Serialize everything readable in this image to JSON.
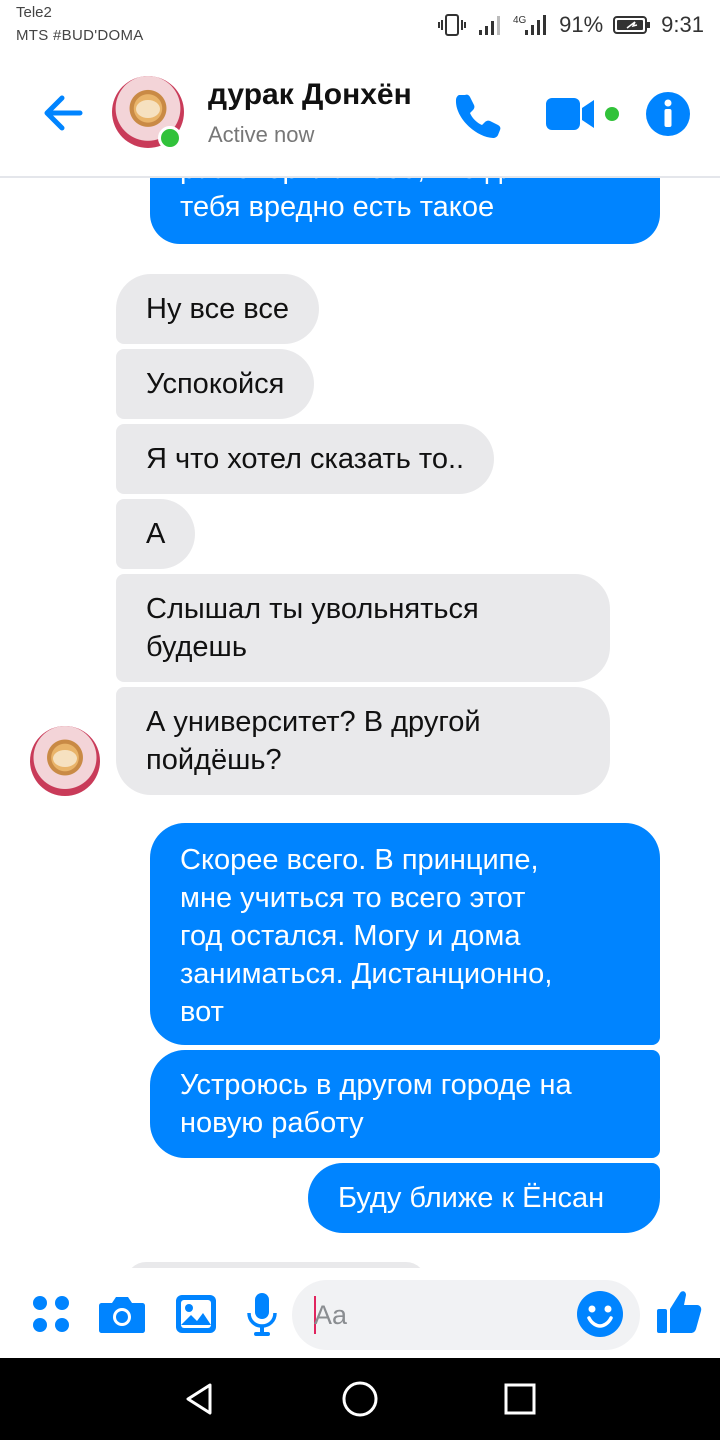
{
  "status_bar": {
    "carrier_line1": "Tele2",
    "carrier_line2": "MTS #BUD'DOMA",
    "battery_percent": "91%",
    "time": "9:31",
    "icons": [
      "vibrate-icon",
      "signal-icon",
      "4g-signal-icon",
      "battery-icon"
    ]
  },
  "header": {
    "contact_name": "дурак Донхён",
    "status": "Active now",
    "accent_color": "#0084ff",
    "online_color": "#31c23a",
    "icons": [
      "back-arrow-icon",
      "phone-icon",
      "video-camera-icon",
      "info-icon"
    ]
  },
  "messages": [
    {
      "direction": "out",
      "text": "разговорила тебе, что для\nтебя вредно есть такое"
    },
    {
      "direction": "in",
      "text": "Ну все все"
    },
    {
      "direction": "in",
      "text": "Успокойся"
    },
    {
      "direction": "in",
      "text": "Я что хотел сказать то.."
    },
    {
      "direction": "in",
      "text": "А"
    },
    {
      "direction": "in",
      "text": "Слышал ты увольняться\nбудешь"
    },
    {
      "direction": "in",
      "text": "А университет? В другой\nпойдёшь?"
    },
    {
      "direction": "out",
      "text": "Скорее всего. В принципе,\nмне учиться то всего этот\nгод остался. Могу и дома\nзаниматься. Дистанционно,\nвот"
    },
    {
      "direction": "out",
      "text": "Устроюсь в другом городе на\nновую работу"
    },
    {
      "direction": "out",
      "text": "Буду ближе к Ёнсан"
    }
  ],
  "composer": {
    "placeholder": "Aa",
    "icons": [
      "more-apps-icon",
      "camera-icon",
      "gallery-icon",
      "microphone-icon",
      "emoji-icon",
      "thumbs-up-icon"
    ]
  },
  "nav_bar": {
    "icons": [
      "back-triangle-icon",
      "home-circle-icon",
      "recents-square-icon"
    ]
  },
  "colors": {
    "outgoing_bubble": "#0084ff",
    "incoming_bubble": "#e9e9eb",
    "nav_background": "#000000"
  }
}
